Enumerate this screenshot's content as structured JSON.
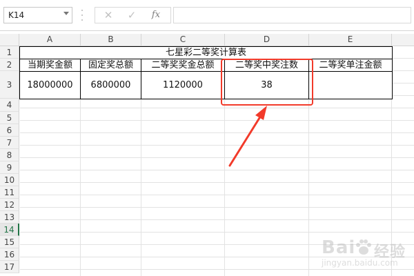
{
  "name_box": {
    "value": "K14"
  },
  "formula_bar": {
    "cancel_glyph": "✕",
    "enter_glyph": "✓",
    "function_label": "fx",
    "value": ""
  },
  "columns": [
    "A",
    "B",
    "C",
    "D",
    "E"
  ],
  "rows": [
    "1",
    "2",
    "3",
    "4",
    "5",
    "6",
    "7",
    "8",
    "9",
    "10",
    "11",
    "12",
    "13",
    "14",
    "15",
    "16",
    "17"
  ],
  "active_row": "14",
  "sheet": {
    "title": "七星彩二等奖计算表",
    "headers": [
      "当期奖金额",
      "固定奖总额",
      "二等奖奖金总额",
      "二等奖中奖注数",
      "二等奖单注金额"
    ],
    "values": [
      "18000000",
      "6800000",
      "1120000",
      "38",
      ""
    ]
  },
  "watermark": {
    "brand": "Bai",
    "brand_suffix": "经验",
    "url": "jingyan.baidu.com"
  },
  "colors": {
    "highlight": "#f23a2a",
    "active_row": "#217346"
  }
}
